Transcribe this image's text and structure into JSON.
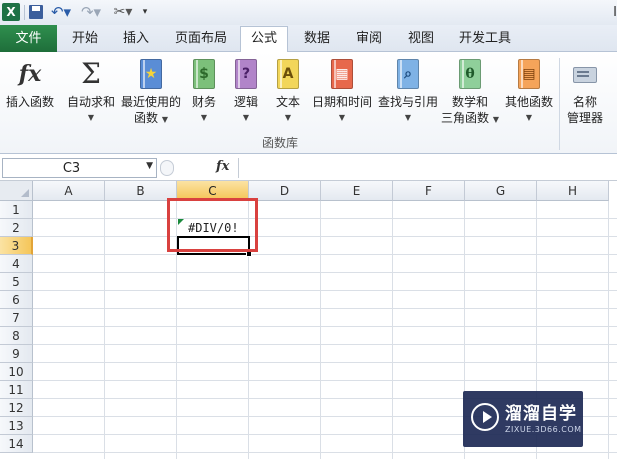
{
  "quick_access": {
    "title_fragment": "I"
  },
  "tabs": [
    {
      "label": "文件"
    },
    {
      "label": "开始"
    },
    {
      "label": "插入"
    },
    {
      "label": "页面布局"
    },
    {
      "label": "公式"
    },
    {
      "label": "数据"
    },
    {
      "label": "审阅"
    },
    {
      "label": "视图"
    },
    {
      "label": "开发工具"
    }
  ],
  "active_tab": "公式",
  "ribbon": {
    "buttons": [
      {
        "label": "插入函数",
        "icon": "insert-function-icon"
      },
      {
        "label": "自动求和",
        "icon": "sigma-icon",
        "has_dropdown": true
      },
      {
        "label": "最近使用的",
        "label2": "函数",
        "icon": "star-book-icon",
        "has_dropdown": true
      },
      {
        "label": "财务",
        "icon": "finance-book-icon",
        "has_dropdown": true
      },
      {
        "label": "逻辑",
        "icon": "logic-book-icon",
        "has_dropdown": true
      },
      {
        "label": "文本",
        "icon": "text-book-icon",
        "has_dropdown": true
      },
      {
        "label": "日期和时间",
        "icon": "date-book-icon",
        "has_dropdown": true
      },
      {
        "label": "查找与引用",
        "icon": "lookup-book-icon",
        "has_dropdown": true
      },
      {
        "label": "数学和",
        "label2": "三角函数",
        "icon": "math-book-icon",
        "has_dropdown": true
      },
      {
        "label": "其他函数",
        "icon": "other-book-icon",
        "has_dropdown": true
      },
      {
        "label": "名称",
        "label2": "管理器",
        "icon": "name-manager-icon"
      }
    ],
    "group_label": "函数库"
  },
  "formula_bar": {
    "name_box": "C3",
    "fx_label": "fx",
    "content": ""
  },
  "grid": {
    "columns": [
      "A",
      "B",
      "C",
      "D",
      "E",
      "F",
      "G",
      "H"
    ],
    "rows": [
      "1",
      "2",
      "3",
      "4",
      "5",
      "6",
      "7",
      "8",
      "9",
      "10",
      "11",
      "12",
      "13",
      "14"
    ],
    "selected_column": "C",
    "selected_row": "3",
    "cells": {
      "C2": "#DIV/0!"
    }
  },
  "colors": {
    "file_tab": "#1e7145",
    "highlight_box": "#d9413f",
    "selected_header": "#f5c65a",
    "error_indicator": "#1a8a3c"
  },
  "watermark": {
    "title": "溜溜自学",
    "url": "ZIXUE.3D66.COM"
  }
}
